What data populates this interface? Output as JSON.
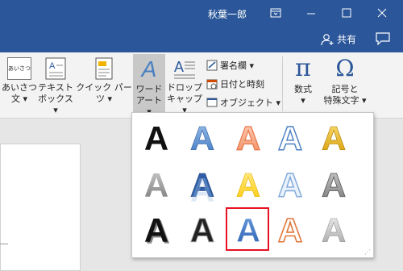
{
  "titlebar": {
    "user": "秋葉一郎",
    "bg": "#2b579a"
  },
  "header": {
    "share_label": "共有"
  },
  "ribbon": {
    "aisatsu_icon_text": "あいさつ",
    "aisatsu_label1": "あいさつ",
    "aisatsu_label2": "文 ▾",
    "textbox_label1": "テキスト",
    "textbox_label2": "ボックス ▾",
    "quickparts_label": "クイック パーツ ▾",
    "wordart_label1": "ワード",
    "wordart_label2": "アート ▾",
    "dropcap_label1": "ドロップ",
    "dropcap_label2": "キャップ ▾",
    "signature_label": "署名欄 ▾",
    "datetime_label": "日付と時刻",
    "object_label": "オブジェクト ▾",
    "equation_label": "数式",
    "equation_arrow": "▾",
    "symbol_label1": "記号と",
    "symbol_label2": "特殊文字 ▾",
    "pi_glyph": "π",
    "omega_glyph": "Ω",
    "group_fragment": "テ"
  },
  "gallery": {
    "items": [
      {
        "glyph": "A",
        "style": "black"
      },
      {
        "glyph": "A",
        "style": "blue-gradient"
      },
      {
        "glyph": "A",
        "style": "orange-outline"
      },
      {
        "glyph": "A",
        "style": "blue-outline"
      },
      {
        "glyph": "A",
        "style": "gold"
      },
      {
        "glyph": "A",
        "style": "gray"
      },
      {
        "glyph": "A",
        "style": "blue-reflect"
      },
      {
        "glyph": "A",
        "style": "yellow"
      },
      {
        "glyph": "A",
        "style": "light-blue-outline"
      },
      {
        "glyph": "A",
        "style": "gray-bevel"
      },
      {
        "glyph": "A",
        "style": "black-shadow"
      },
      {
        "glyph": "A",
        "style": "black-bold"
      },
      {
        "glyph": "A",
        "style": "blue-selected"
      },
      {
        "glyph": "A",
        "style": "orange-white"
      },
      {
        "glyph": "A",
        "style": "silver"
      }
    ],
    "selected_index": 12
  },
  "colors": {
    "accent": "#2b579a",
    "selection": "#e81123"
  }
}
